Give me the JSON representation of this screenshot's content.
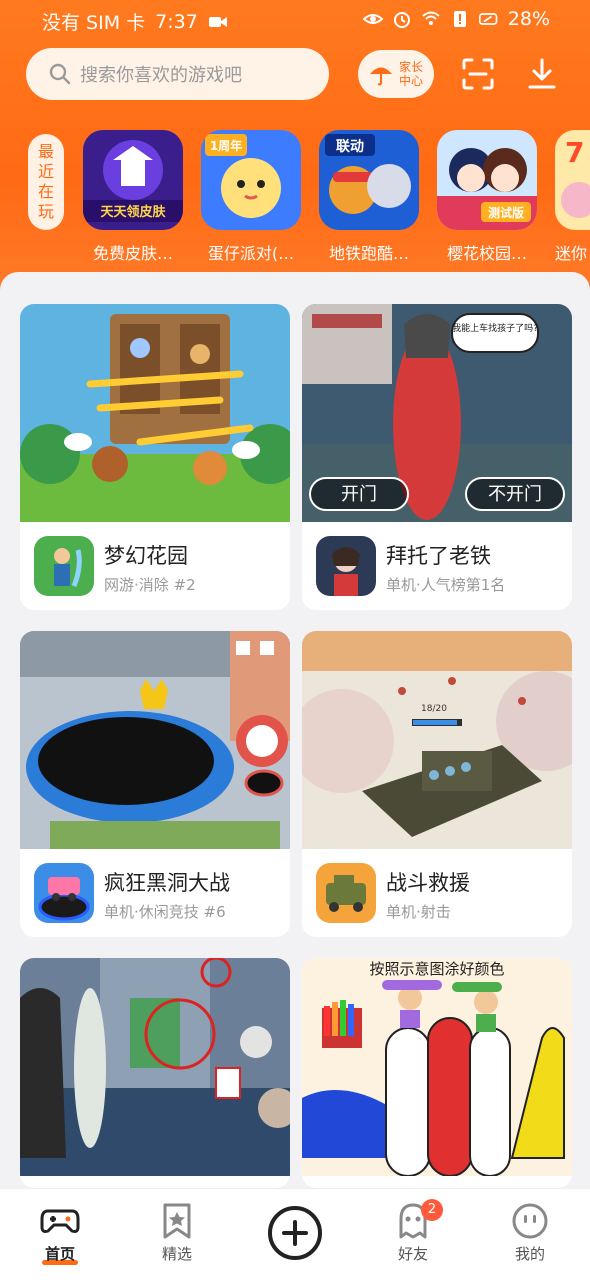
{
  "status_bar": {
    "carrier": "没有 SIM 卡",
    "time": "7:37",
    "battery": "28%"
  },
  "header": {
    "search": {
      "placeholder": "搜索你喜欢的游戏吧"
    },
    "parent_button": {
      "label_line1": "家长",
      "label_line2": "中心"
    }
  },
  "recent": {
    "label": [
      "最",
      "近",
      "在",
      "玩"
    ],
    "items": [
      {
        "name": "免费皮肤…",
        "icon_text": "天天领皮肤"
      },
      {
        "name": "蛋仔派对(…",
        "icon_text": "1周年"
      },
      {
        "name": "地铁跑酷…",
        "icon_text": "联动"
      },
      {
        "name": "樱花校园…",
        "icon_text": "测试版"
      },
      {
        "name": "迷你",
        "icon_text": "7"
      }
    ]
  },
  "cards": [
    {
      "title": "梦幻花园",
      "subtitle": "网游·消除 #2"
    },
    {
      "title": "拜托了老铁",
      "subtitle": "单机·人气榜第1名",
      "image_bubble": "我能上车找孩子了吗?",
      "image_btn_left": "开门",
      "image_btn_right": "不开门"
    },
    {
      "title": "疯狂黑洞大战",
      "subtitle": "单机·休闲竞技 #6"
    },
    {
      "title": "战斗救援",
      "subtitle": "单机·射击",
      "image_counter": "18/20"
    },
    {
      "title": "",
      "subtitle": ""
    },
    {
      "title": "",
      "subtitle": "",
      "image_caption": "按照示意图涂好颜色"
    }
  ],
  "bottom_nav": {
    "items": [
      {
        "label": "首页",
        "icon": "gamepad-icon"
      },
      {
        "label": "精选",
        "icon": "bookmark-star-icon"
      },
      {
        "label": "",
        "icon": "plus-circle-icon"
      },
      {
        "label": "好友",
        "icon": "ghost-icon",
        "badge": "2"
      },
      {
        "label": "我的",
        "icon": "face-icon"
      }
    ]
  },
  "colors": {
    "accent": "#ff6a14",
    "background": "#f2f2f4"
  }
}
